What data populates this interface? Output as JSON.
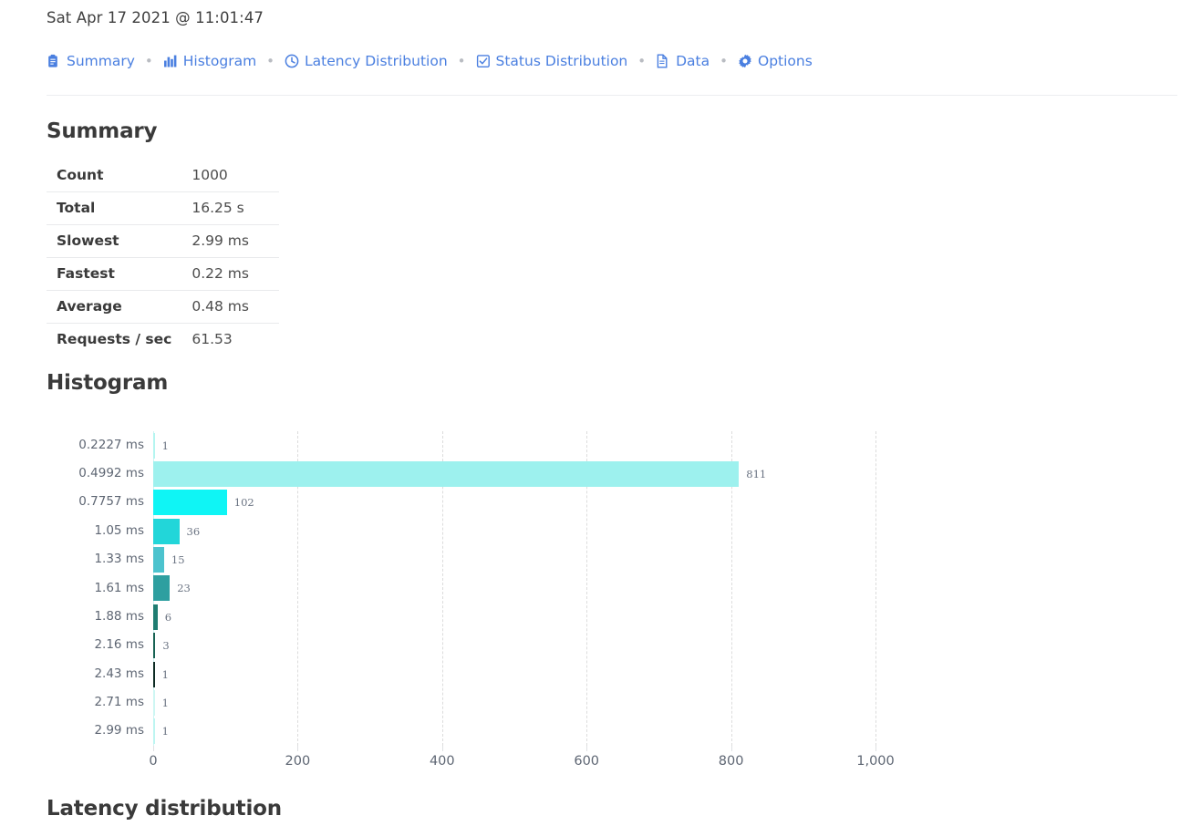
{
  "timestamp": "Sat Apr 17 2021 @ 11:01:47",
  "nav": {
    "separator": "•",
    "items": [
      {
        "label": "Summary",
        "icon": "clipboard-icon"
      },
      {
        "label": "Histogram",
        "icon": "bar-chart-icon"
      },
      {
        "label": "Latency Distribution",
        "icon": "clock-icon"
      },
      {
        "label": "Status Distribution",
        "icon": "checkbox-icon"
      },
      {
        "label": "Data",
        "icon": "file-icon"
      },
      {
        "label": "Options",
        "icon": "gear-icon"
      }
    ]
  },
  "sections": {
    "summary_heading": "Summary",
    "histogram_heading": "Histogram",
    "latency_heading": "Latency distribution"
  },
  "summary": {
    "rows": [
      {
        "key": "Count",
        "value": "1000"
      },
      {
        "key": "Total",
        "value": "16.25 s"
      },
      {
        "key": "Slowest",
        "value": "2.99 ms"
      },
      {
        "key": "Fastest",
        "value": "0.22 ms"
      },
      {
        "key": "Average",
        "value": "0.48 ms"
      },
      {
        "key": "Requests / sec",
        "value": "61.53"
      }
    ]
  },
  "colors": {
    "link": "#4a7fe0",
    "heading": "#3a3a3a",
    "grid": "#dcdcdc",
    "bar_label": "#6a7382"
  },
  "chart_data": {
    "type": "bar",
    "orientation": "horizontal",
    "title": "Histogram",
    "xlabel": "",
    "ylabel": "",
    "xlim": [
      0,
      1000
    ],
    "grid": true,
    "legend": false,
    "xticks": [
      "0",
      "200",
      "400",
      "600",
      "800",
      "1,000"
    ],
    "xtick_values": [
      0,
      200,
      400,
      600,
      800,
      1000
    ],
    "categories": [
      "0.2227 ms",
      "0.4992 ms",
      "0.7757 ms",
      "1.05 ms",
      "1.33 ms",
      "1.61 ms",
      "1.88 ms",
      "2.16 ms",
      "2.43 ms",
      "2.71 ms",
      "2.99 ms"
    ],
    "values": [
      1,
      811,
      102,
      36,
      15,
      23,
      6,
      3,
      1,
      1,
      1
    ],
    "bar_labels": [
      "1",
      "811",
      "102",
      "36",
      "15",
      "23",
      "6",
      "3",
      "1",
      "1",
      "1"
    ],
    "bar_colors": [
      "#b4f5f0",
      "#9df1ee",
      "#0ff5f5",
      "#22d6d9",
      "#4cc3ce",
      "#2e9fa0",
      "#1f7d72",
      "#176253",
      "#0d2b23",
      "#cdf6f3",
      "#bdf5f1"
    ]
  }
}
